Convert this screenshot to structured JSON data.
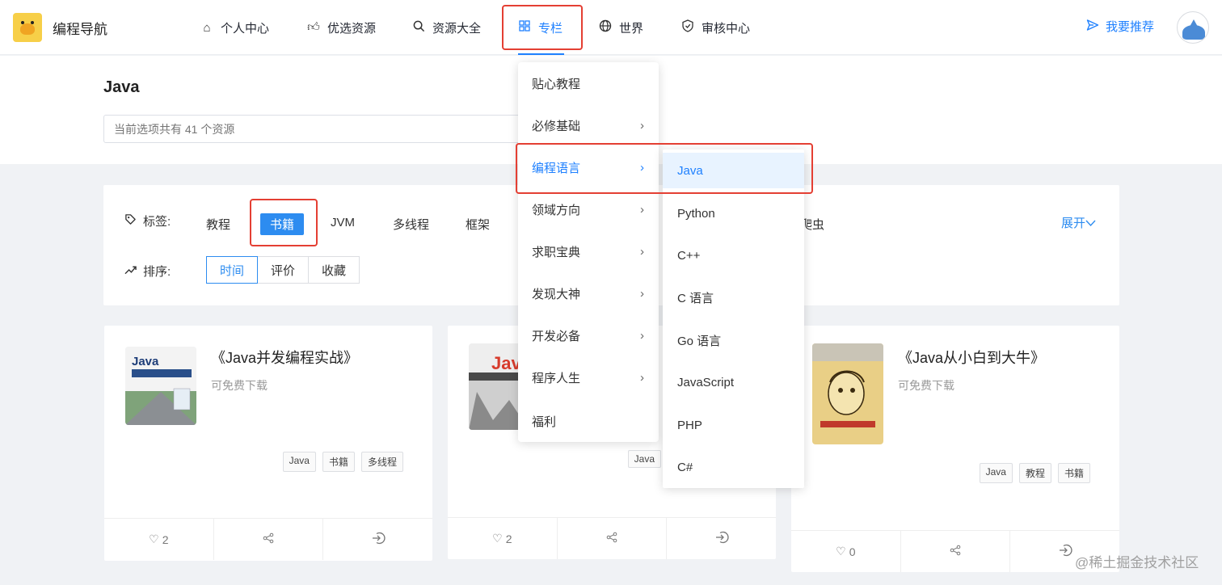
{
  "header": {
    "brand": "编程导航",
    "nav": [
      {
        "label": "个人中心",
        "icon": "home-icon"
      },
      {
        "label": "优选资源",
        "icon": "thumbs-up-icon"
      },
      {
        "label": "资源大全",
        "icon": "search-icon"
      },
      {
        "label": "专栏",
        "icon": "grid-icon"
      },
      {
        "label": "世界",
        "icon": "globe-icon"
      },
      {
        "label": "审核中心",
        "icon": "shield-icon"
      }
    ],
    "recommend_label": "我要推荐",
    "accent_color": "#1e80ff"
  },
  "page": {
    "title": "Java",
    "search_placeholder": "当前选项共有 41 个资源"
  },
  "filters": {
    "tags_label": "标签:",
    "tags": [
      "教程",
      "书籍",
      "JVM",
      "多线程",
      "框架",
      "爬虫"
    ],
    "active_tag": "书籍",
    "expand_label": "展开",
    "sort_label": "排序:",
    "sort_options": [
      "时间",
      "评价",
      "收藏"
    ],
    "active_sort": "时间"
  },
  "cards": [
    {
      "title": "《Java并发编程实战》",
      "sub": "可免费下载",
      "tags": [
        "Java",
        "书籍",
        "多线程"
      ],
      "likes": "2"
    },
    {
      "title": "",
      "sub": "",
      "tags": [
        "Java"
      ],
      "likes": "2"
    },
    {
      "title": "《Java从小白到大牛》",
      "sub": "可免费下载",
      "tags": [
        "Java",
        "教程",
        "书籍"
      ],
      "likes": "0"
    }
  ],
  "menu": {
    "level1": [
      "贴心教程",
      "必修基础",
      "编程语言",
      "领域方向",
      "求职宝典",
      "发现大神",
      "开发必备",
      "程序人生",
      "福利"
    ],
    "level1_active": "编程语言",
    "level2": [
      "Java",
      "Python",
      "C++",
      "C 语言",
      "Go 语言",
      "JavaScript",
      "PHP",
      "C#"
    ],
    "level2_active": "Java"
  },
  "watermark": "@稀土掘金技术社区"
}
